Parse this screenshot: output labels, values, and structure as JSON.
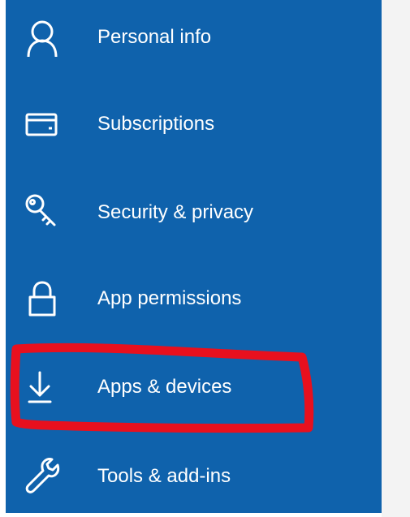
{
  "colors": {
    "sidebar_bg": "#0f62ac",
    "text": "#ffffff",
    "content_bg": "#f3f3f3",
    "annotation": "#e8101e"
  },
  "nav": {
    "items": [
      {
        "label": "Personal info",
        "icon": "person-icon"
      },
      {
        "label": "Subscriptions",
        "icon": "credit-card-icon"
      },
      {
        "label": "Security & privacy",
        "icon": "key-icon"
      },
      {
        "label": "App permissions",
        "icon": "lock-icon"
      },
      {
        "label": "Apps & devices",
        "icon": "download-icon",
        "annotated": true
      },
      {
        "label": "Tools & add-ins",
        "icon": "wrench-icon"
      }
    ]
  }
}
